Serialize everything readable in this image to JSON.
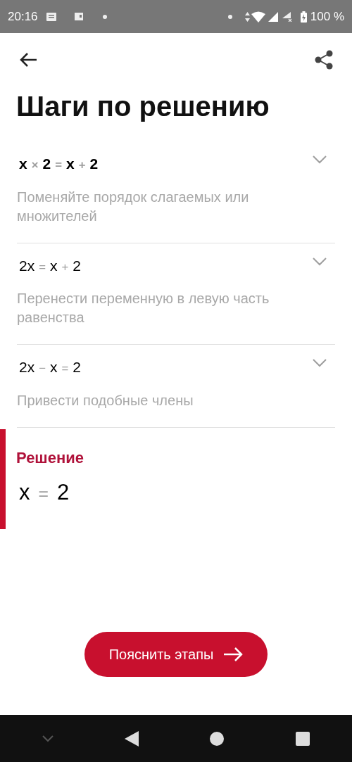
{
  "status_bar": {
    "time": "20:16",
    "battery": "100 %"
  },
  "title": "Шаги по решению",
  "steps": [
    {
      "bold": true,
      "equation": [
        {
          "kind": "term",
          "text": "x"
        },
        {
          "kind": "op",
          "text": "×"
        },
        {
          "kind": "term",
          "text": "2"
        },
        {
          "kind": "op",
          "text": "="
        },
        {
          "kind": "term",
          "text": "x"
        },
        {
          "kind": "op",
          "text": "+"
        },
        {
          "kind": "term",
          "text": "2"
        }
      ],
      "description": "Поменяйте порядок слагаемых или множителей"
    },
    {
      "bold": false,
      "equation": [
        {
          "kind": "term",
          "text": "2x"
        },
        {
          "kind": "op",
          "text": "="
        },
        {
          "kind": "term",
          "text": "x"
        },
        {
          "kind": "op",
          "text": "+"
        },
        {
          "kind": "term",
          "text": "2"
        }
      ],
      "description": "Перенести переменную в левую часть равенства"
    },
    {
      "bold": false,
      "equation": [
        {
          "kind": "term",
          "text": "2x"
        },
        {
          "kind": "op",
          "text": "−"
        },
        {
          "kind": "term",
          "text": "x"
        },
        {
          "kind": "op",
          "text": "="
        },
        {
          "kind": "term",
          "text": "2"
        }
      ],
      "description": "Привести подобные члены"
    }
  ],
  "solution": {
    "label": "Решение",
    "equation": [
      {
        "kind": "term",
        "text": "x"
      },
      {
        "kind": "op",
        "text": "="
      },
      {
        "kind": "term",
        "text": "2"
      }
    ]
  },
  "button": "Пояснить этапы"
}
